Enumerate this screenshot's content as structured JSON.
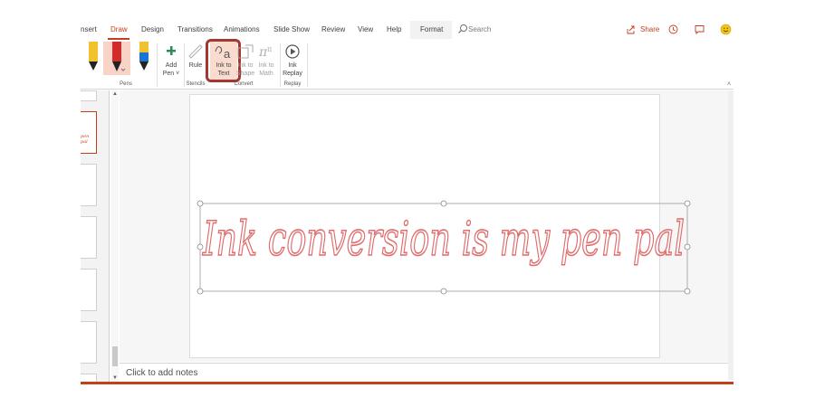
{
  "tabs": [
    {
      "label": "nsert",
      "active": false
    },
    {
      "label": "Draw",
      "active": true
    },
    {
      "label": "Design",
      "active": false
    },
    {
      "label": "Transitions",
      "active": false
    },
    {
      "label": "Animations",
      "active": false
    },
    {
      "label": "Slide Show",
      "active": false
    },
    {
      "label": "Review",
      "active": false
    },
    {
      "label": "View",
      "active": false
    },
    {
      "label": "Help",
      "active": false
    },
    {
      "label": "Format",
      "active": false
    }
  ],
  "search": {
    "placeholder": "Search"
  },
  "share_label": "Share",
  "ribbon": {
    "add_pen": {
      "line1": "Add",
      "line2": "Pen ˅"
    },
    "ruler": {
      "line1": "Rule"
    },
    "ink_to_text": {
      "line1": "Ink to",
      "line2": "Text"
    },
    "ink_to_shape": {
      "line1": "Ink to",
      "line2": "Shape"
    },
    "ink_to_math": {
      "line1": "Ink to",
      "line2": "Math"
    },
    "ink_replay": {
      "line1": "Ink",
      "line2": "Replay"
    },
    "groups": {
      "pens": "Pens",
      "stencils": "Stencils",
      "convert": "Convert",
      "replay": "Replay"
    }
  },
  "thumbnail": {
    "text": "pen pal"
  },
  "slide": {
    "ink_text": "Ink conversion is my pen pal"
  },
  "notes": {
    "placeholder": "Click to add notes"
  },
  "colors": {
    "accent": "#c43e1c",
    "ink": "#e06c6c",
    "highlight": "#a5382e"
  }
}
